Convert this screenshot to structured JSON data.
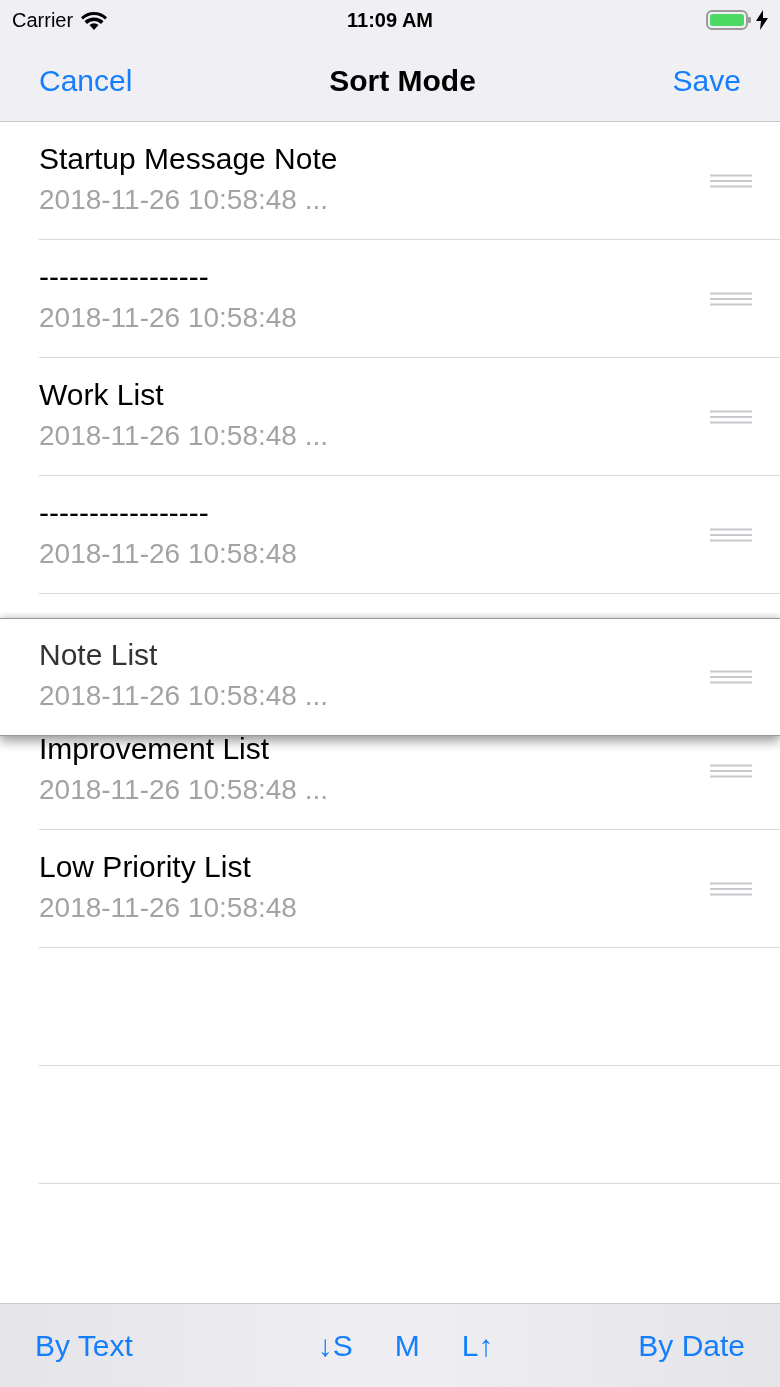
{
  "status_bar": {
    "carrier": "Carrier",
    "time": "11:09 AM"
  },
  "nav": {
    "cancel": "Cancel",
    "title": "Sort Mode",
    "save": "Save"
  },
  "rows": [
    {
      "kind": "note",
      "title": "Startup Message Note",
      "subtitle": "2018-11-26 10:58:48 ..."
    },
    {
      "kind": "note",
      "title": "-----------------",
      "subtitle": "2018-11-26 10:58:48"
    },
    {
      "kind": "note",
      "title": "Work List",
      "subtitle": "2018-11-26 10:58:48 ..."
    },
    {
      "kind": "note",
      "title": "-----------------",
      "subtitle": "2018-11-26 10:58:48"
    },
    {
      "kind": "gap"
    },
    {
      "kind": "note",
      "title": "Improvement List",
      "subtitle": "2018-11-26 10:58:48 ..."
    },
    {
      "kind": "note",
      "title": "Low Priority List",
      "subtitle": "2018-11-26 10:58:48"
    },
    {
      "kind": "blank"
    },
    {
      "kind": "blank"
    }
  ],
  "dragged_row": {
    "title": "Note List",
    "subtitle": "2018-11-26 10:58:48 ..."
  },
  "toolbar": {
    "left": "By Text",
    "sizes": [
      "↓S",
      "M",
      "L↑"
    ],
    "right": "By Date"
  }
}
